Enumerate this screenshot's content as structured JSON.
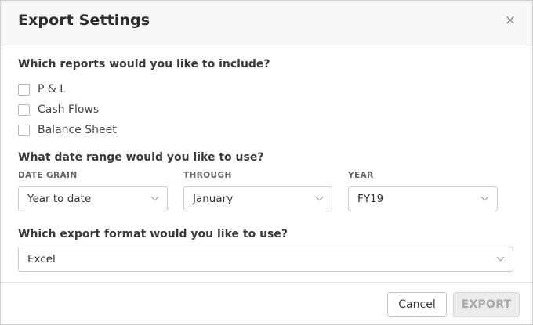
{
  "dialog": {
    "title": "Export Settings",
    "close_symbol": "×"
  },
  "reports": {
    "question": "Which reports would you like to include?",
    "options": [
      {
        "label": "P & L",
        "checked": false
      },
      {
        "label": "Cash Flows",
        "checked": false
      },
      {
        "label": "Balance Sheet",
        "checked": false
      }
    ]
  },
  "date_range": {
    "question": "What date range would you like to use?",
    "date_grain": {
      "label": "DATE GRAIN",
      "value": "Year to date"
    },
    "through": {
      "label": "THROUGH",
      "value": "January"
    },
    "year": {
      "label": "YEAR",
      "value": "FY19"
    }
  },
  "format": {
    "question": "Which export format would you like to use?",
    "value": "Excel"
  },
  "footer": {
    "cancel_label": "Cancel",
    "export_label": "EXPORT",
    "export_enabled": false
  },
  "icons": {
    "close": "close-icon",
    "dropdown": "chevron-down-icon",
    "checkbox": "checkbox-unchecked-icon"
  }
}
